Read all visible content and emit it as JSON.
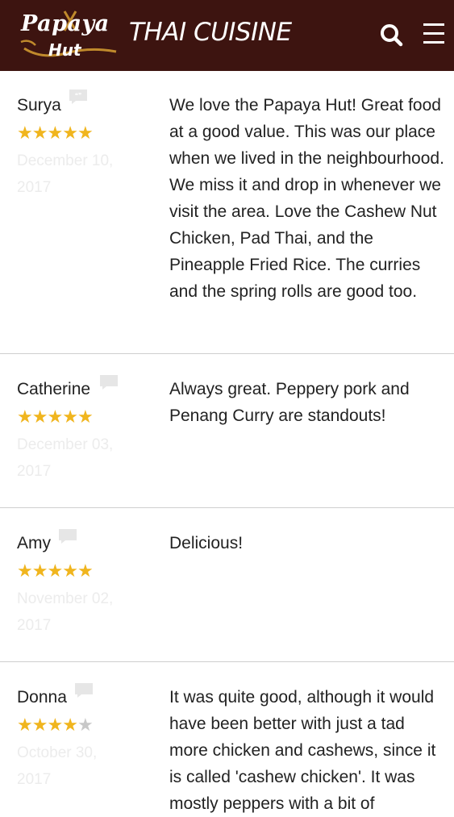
{
  "header": {
    "logo_top": "Papaya",
    "logo_bottom": "Hut",
    "subtitle": "THAI CUISINE",
    "icons": {
      "search": "search-icon",
      "menu": "hamburger-menu-icon"
    },
    "colors": {
      "background": "#3d1410",
      "logo_accent": "#c08a2c"
    }
  },
  "reviews": [
    {
      "name": "Surya",
      "rating": 5,
      "date": "December 10, 2017",
      "text": "We love the Papaya Hut! Great food at a good value. This was our place when we lived in the neighbourhood. We miss it and drop in whenever we visit the area. Love the Cashew Nut Chicken, Pad Thai, and the Pineapple Fried Rice. The curries and the spring rolls are good too."
    },
    {
      "name": "Catherine",
      "rating": 5,
      "date": "December 03, 2017",
      "text": "Always great. Peppery pork and Penang Curry are standouts!"
    },
    {
      "name": "Amy",
      "rating": 5,
      "date": "November 02, 2017",
      "text": "Delicious!"
    },
    {
      "name": "Donna",
      "rating": 4,
      "date": "October 30, 2017",
      "text": "It was quite good, although it would have been better with just a tad more chicken and cashews, since it is called 'cashew chicken'. It was mostly peppers with a bit of"
    }
  ],
  "colors": {
    "star": "#f0b51e",
    "star_empty": "#c8c8c8",
    "divider": "#cfcfcf",
    "date_text": "#ececec"
  }
}
